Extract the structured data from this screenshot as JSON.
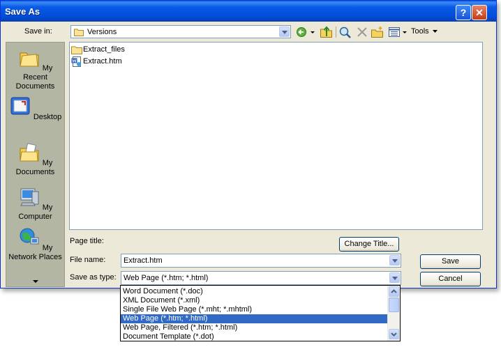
{
  "window": {
    "title": "Save As",
    "help_label": "?",
    "close_label": "✕"
  },
  "toolbar": {
    "save_in_label": "Save in:",
    "location": "Versions",
    "tools_label": "Tools",
    "icons": [
      "back-icon",
      "up-folder-icon",
      "search-web-icon",
      "delete-icon",
      "new-folder-icon",
      "views-icon"
    ]
  },
  "places": [
    {
      "label": "My Recent Documents",
      "icon": "recent-documents-icon"
    },
    {
      "label": "Desktop",
      "icon": "desktop-icon"
    },
    {
      "label": "My Documents",
      "icon": "my-documents-icon"
    },
    {
      "label": "My Computer",
      "icon": "my-computer-icon"
    },
    {
      "label": "My Network Places",
      "icon": "network-places-icon"
    }
  ],
  "files": [
    {
      "name": "Extract_files",
      "icon": "folder-icon"
    },
    {
      "name": "Extract.htm",
      "icon": "word-html-file-icon"
    }
  ],
  "form": {
    "page_title_label": "Page title:",
    "change_title_button": "Change Title...",
    "file_name_label": "File name:",
    "file_name_value": "Extract.htm",
    "save_as_type_label": "Save as type:",
    "save_as_type_value": "Web Page (*.htm; *.html)",
    "save_button": "Save",
    "cancel_button": "Cancel"
  },
  "type_options": [
    "Word Document (*.doc)",
    "XML Document (*.xml)",
    "Single File Web Page (*.mht; *.mhtml)",
    "Web Page (*.htm; *.html)",
    "Web Page, Filtered (*.htm; *.html)",
    "Document Template (*.dot)"
  ],
  "selected_option": "Web Page (*.htm; *.html)",
  "colors": {
    "title_bar": "#0a5ae6",
    "selection": "#316ac5",
    "dialog_bg": "#ece9d8"
  }
}
